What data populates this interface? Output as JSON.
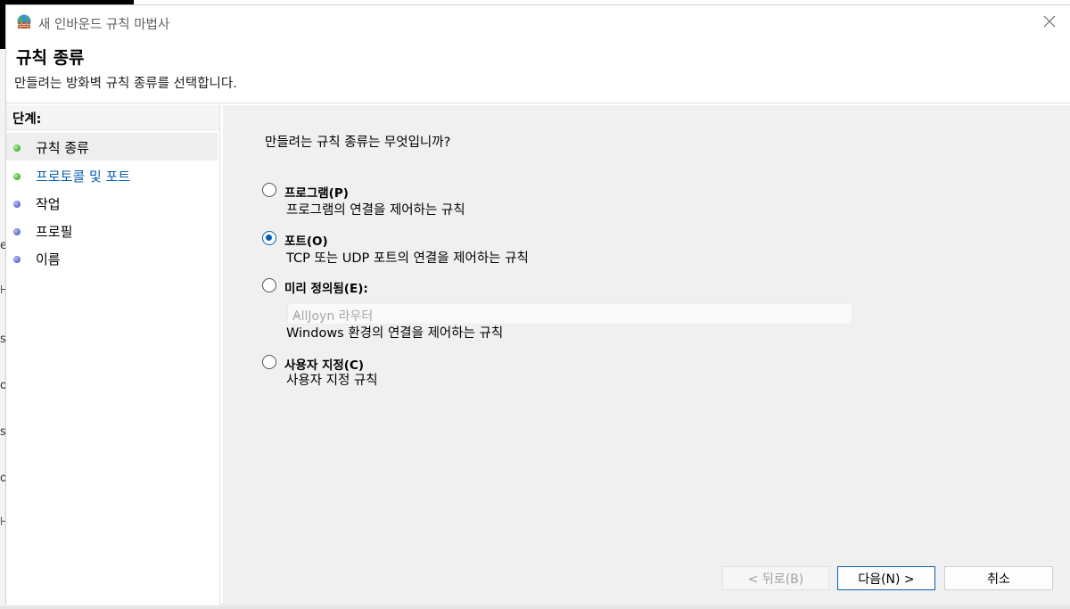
{
  "background": {
    "edge_chars": [
      "e",
      "⊢",
      "s",
      "o",
      "s",
      "o",
      "⊢"
    ]
  },
  "window": {
    "title": "새 인바운드 규칙 마법사",
    "close_icon": "close-icon"
  },
  "header": {
    "title": "규칙 종류",
    "description": "만들려는 방화벽 규칙 종류를 선택합니다."
  },
  "steps": {
    "heading": "단계:",
    "items": [
      {
        "label": "규칙 종류",
        "status": "green",
        "current": true
      },
      {
        "label": "프로토콜 및 포트",
        "status": "green",
        "current": false
      },
      {
        "label": "작업",
        "status": "blue",
        "current": false
      },
      {
        "label": "프로필",
        "status": "blue",
        "current": false
      },
      {
        "label": "이름",
        "status": "blue",
        "current": false
      }
    ]
  },
  "content": {
    "question": "만들려는 규칙 종류는 무엇입니까?",
    "options": [
      {
        "label": "프로그램(P)",
        "description": "프로그램의 연결을 제어하는 규칙",
        "checked": false
      },
      {
        "label": "포트(O)",
        "description": "TCP 또는 UDP 포트의 연결을 제어하는 규칙",
        "checked": true
      },
      {
        "label": "미리 정의됨(E):",
        "description": "Windows 환경의 연결을 제어하는 규칙",
        "checked": false,
        "select_value": "AllJoyn 라우터"
      },
      {
        "label": "사용자 지정(C)",
        "description": "사용자 지정 규칙",
        "checked": false
      }
    ]
  },
  "buttons": {
    "back": "< 뒤로(B)",
    "next": "다음(N) >",
    "cancel": "취소"
  },
  "colors": {
    "accent": "#0a5fb0",
    "content_bg": "#f0f0f0",
    "step_green": "#3fae2a",
    "step_blue": "#5a63c9"
  }
}
